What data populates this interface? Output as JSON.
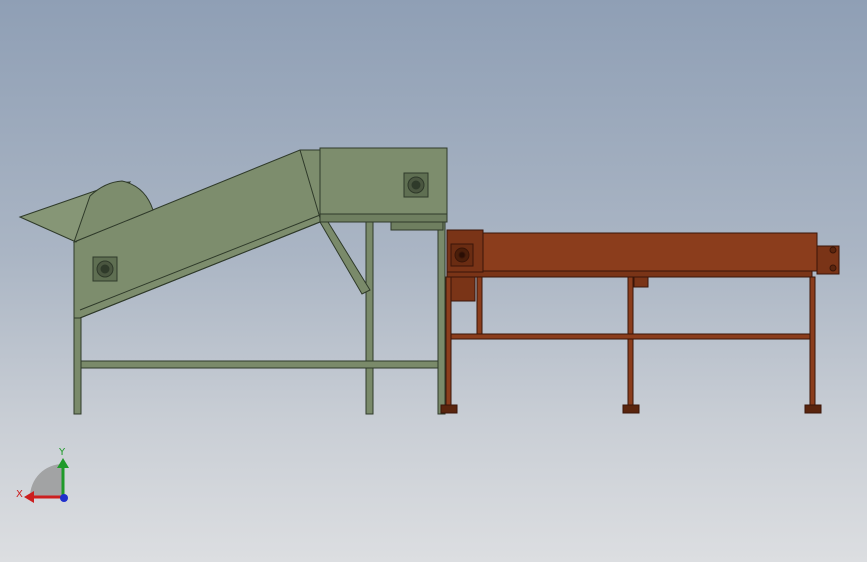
{
  "scene": {
    "title": "",
    "background_top": "#8f9fb5",
    "background_bottom": "#dcdee1"
  },
  "parts": {
    "hopper_conveyor": {
      "color": "#7a8a6a",
      "edge": "#2f3a2a"
    },
    "flat_conveyor": {
      "color": "#8b3d1c",
      "edge": "#3a1508"
    }
  },
  "triad": {
    "x_label": "X",
    "y_label": "Y",
    "x_color": "#cc1f1f",
    "y_color": "#1f9a2a",
    "z_color": "#1f2fcc"
  }
}
